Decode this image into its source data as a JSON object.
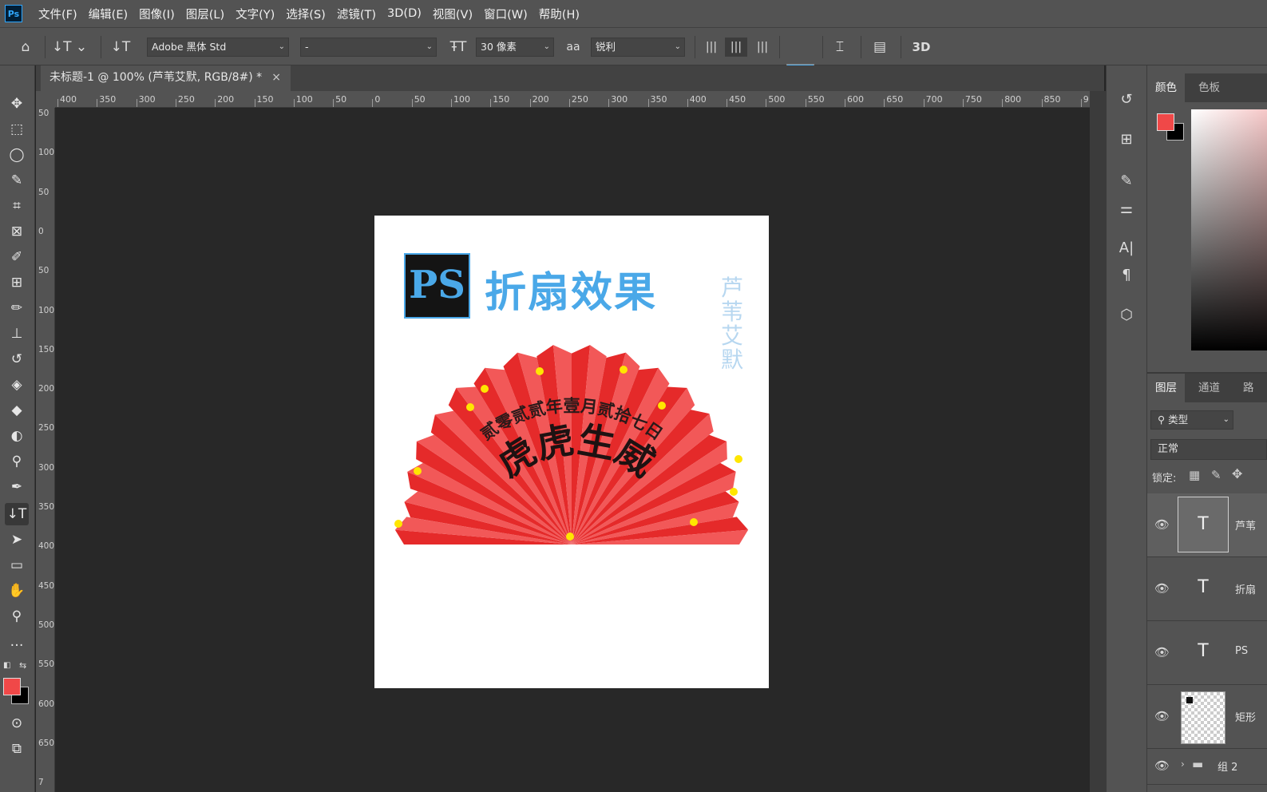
{
  "app": {
    "logo": "Ps"
  },
  "menu": [
    "文件(F)",
    "编辑(E)",
    "图像(I)",
    "图层(L)",
    "文字(Y)",
    "选择(S)",
    "滤镜(T)",
    "3D(D)",
    "视图(V)",
    "窗口(W)",
    "帮助(H)"
  ],
  "options": {
    "font_family": "Adobe 黑体 Std",
    "font_style": "-",
    "font_size": "30 像素",
    "antialias_icon": "aa",
    "antialias": "锐利",
    "text_color": "#4aa8e8",
    "three_d": "3D"
  },
  "document": {
    "tab_title": "未标题-1 @ 100% (芦苇艾默, RGB/8#) *",
    "close": "×"
  },
  "ruler": {
    "h": [
      "400",
      "350",
      "300",
      "250",
      "200",
      "150",
      "100",
      "50",
      "0",
      "50",
      "100",
      "150",
      "200",
      "250",
      "300",
      "350",
      "400",
      "450",
      "500",
      "550",
      "600",
      "650",
      "700",
      "750",
      "800",
      "850",
      "9"
    ],
    "v": [
      "50",
      "100",
      "50",
      "0",
      "50",
      "100",
      "150",
      "200",
      "250",
      "300",
      "350",
      "400",
      "450",
      "500",
      "550",
      "600",
      "650",
      "7"
    ]
  },
  "artwork": {
    "badge": "PS",
    "title": "折扇效果",
    "side_text": "芦苇艾默",
    "date_arc": "贰零贰贰年壹月贰拾七日",
    "greeting": "虎虎生威"
  },
  "colors": {
    "foreground": "#f04848",
    "background": "#000000",
    "accent": "#4aa8e8"
  },
  "panels": {
    "color_tabs": [
      "颜色",
      "色板"
    ],
    "layer_tabs": [
      "图层",
      "通道",
      "路"
    ],
    "filter_kind": "类型",
    "blend_mode": "正常",
    "lock_label": "锁定:"
  },
  "layers": [
    {
      "name": "芦苇",
      "thumb": "T"
    },
    {
      "name": "折扇",
      "thumb": "T"
    },
    {
      "name": "PS",
      "thumb": "T"
    },
    {
      "name": "矩形",
      "thumb": ""
    },
    {
      "name": "组 2",
      "thumb": ""
    }
  ]
}
